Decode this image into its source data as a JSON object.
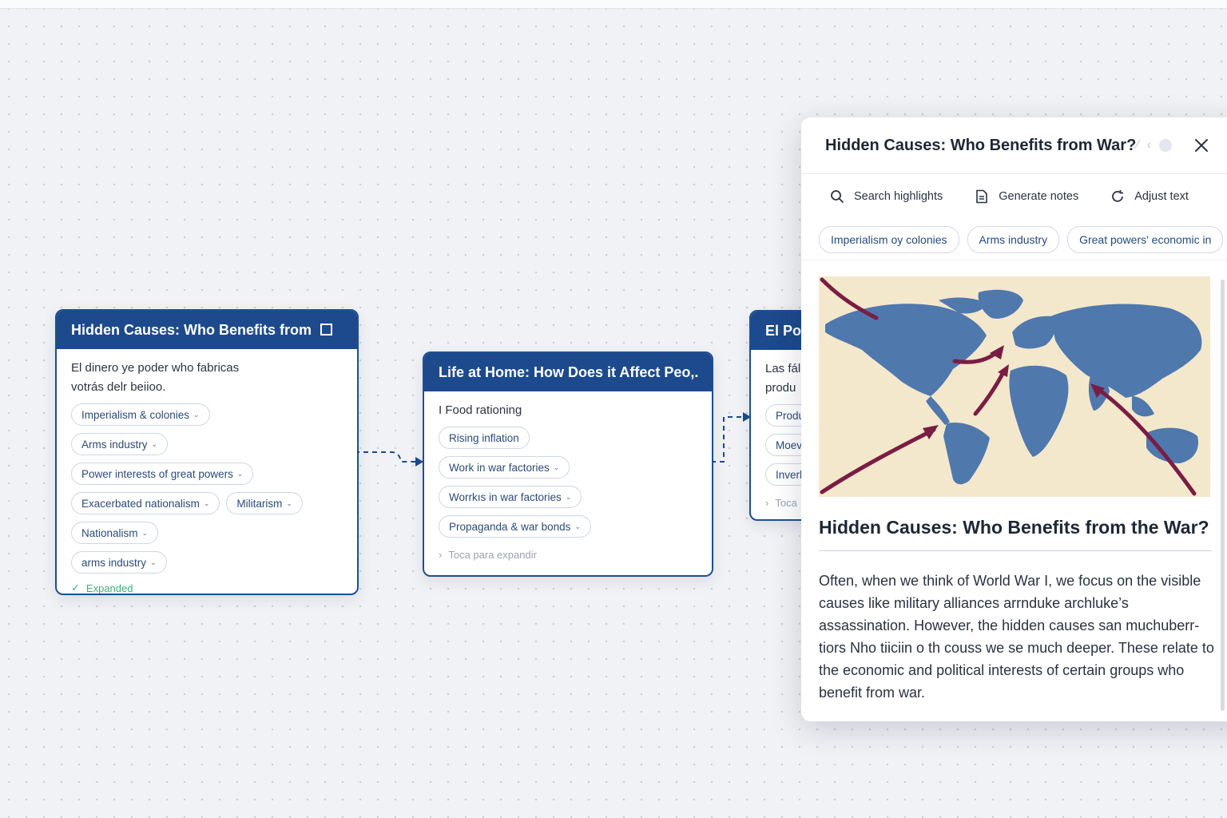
{
  "card1": {
    "title": "Hidden Causes: Who Benefits from",
    "description_line1": "El dinero ye poder who fabricas",
    "description_line2": "votrás delr beiioo.",
    "chips": [
      "Imperialism & colonies",
      "Arms industry",
      "Power interests of great powers",
      "Exacerbated nationalism",
      "Militarism",
      "Nationalism",
      "arms industry"
    ],
    "footer": "Expanded"
  },
  "card2": {
    "title": "Life at Home: How Does it Affect Peo,.",
    "description": "I Food rationing",
    "chips": [
      "Rising inflation",
      "Work in war factories",
      "Worrkıs in war factories",
      "Propaganda & war bonds"
    ],
    "footer": "Toca para expandir"
  },
  "card3": {
    "title": "El Poc",
    "description_line1": "Las fál",
    "description_line2": "produ",
    "chips": [
      "Produ",
      "Moev.",
      "Inverl"
    ],
    "footer": "Toca"
  },
  "panel": {
    "title": "Hidden Causes: Who Benefits from War?",
    "tools": [
      "Search highlights",
      "Generate notes",
      "Adjust text"
    ],
    "tags": [
      "Imperialism oy colonies",
      "Arms industry",
      "Great powers' economic in"
    ],
    "article_title": "Hidden Causes: Who Benefits from the War?",
    "article_body": "Often, when we think of World War I, we focus on the visible causes like military alliances arrnduke archluke’s assassination. However, the hidden causes san muchuberr-tiors Nho tiiciin o th couss we se much deeper. These relate to the economic and political interests of certain groups who benefit from war."
  },
  "colors": {
    "header_blue": "#1c4a8c",
    "chip_text": "#2b4a78",
    "arrow_maroon": "#7a1d44",
    "map_land": "#4f78ad",
    "map_sea": "#f4e8cc",
    "expanded_green": "#3fae7a"
  }
}
